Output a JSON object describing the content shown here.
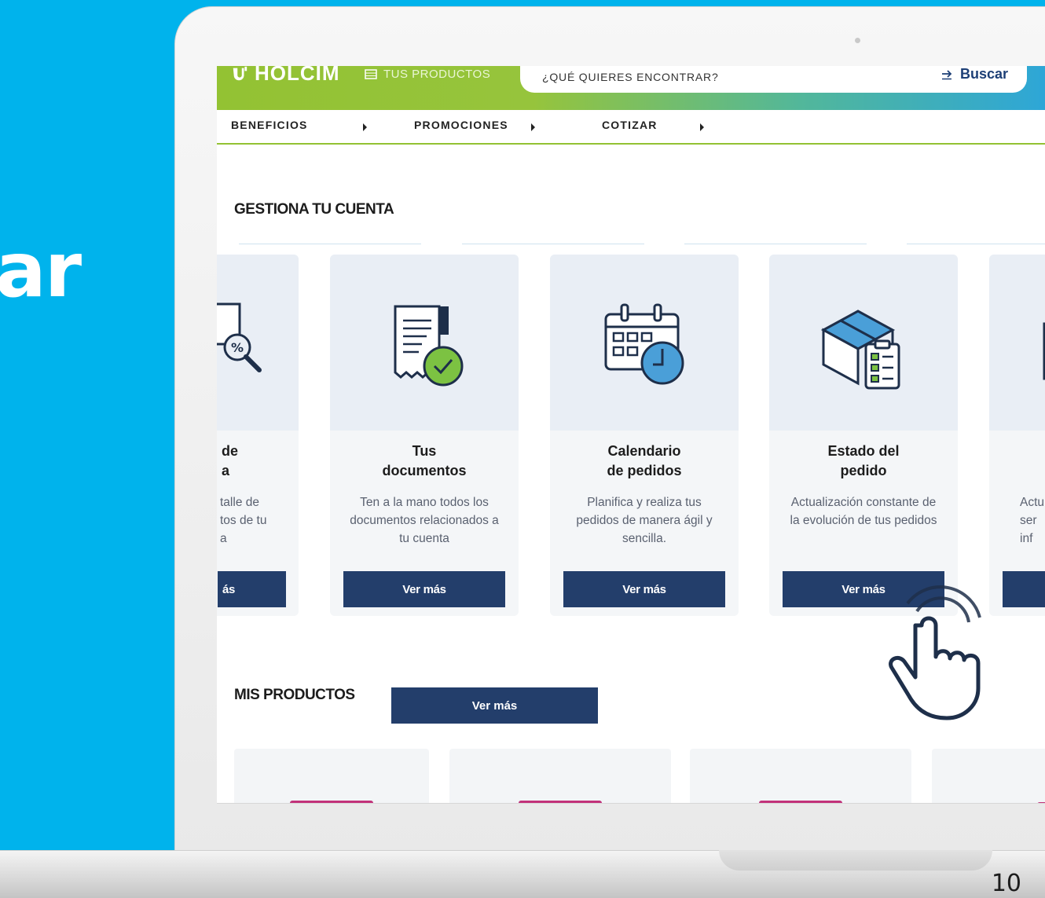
{
  "slide": {
    "word": "ar",
    "page_number": "10"
  },
  "header": {
    "logo_text": "HOLCIM",
    "products_link": "TUS PRODUCTOS",
    "search": {
      "placeholder": "¿QUÉ QUIERES ENCONTRAR?",
      "button_label": "Buscar"
    },
    "nav": [
      "BENEFICIOS",
      "PROMOCIONES",
      "COTIZAR"
    ]
  },
  "account": {
    "title": "GESTIONA TU CUENTA",
    "cards": [
      {
        "title": "de\na",
        "description": "talle de\ntos de tu\na",
        "button": "ás",
        "icon": "receipt-search-icon"
      },
      {
        "title": "Tus\ndocumentos",
        "description": "Ten a la mano todos los documentos relacionados a tu cuenta",
        "button": "Ver más",
        "icon": "document-check-icon"
      },
      {
        "title": "Calendario\nde pedidos",
        "description": "Planifica y realiza tus pedidos de manera ágil y sencilla.",
        "button": "Ver más",
        "icon": "calendar-clock-icon"
      },
      {
        "title": "Estado del\npedido",
        "description": "Actualización constante de la evolución de tus pedidos",
        "button": "Ver más",
        "icon": "box-checklist-icon"
      },
      {
        "title": "",
        "description": "Actu\nser\ninf",
        "button": "",
        "icon": "document-icon"
      }
    ]
  },
  "products": {
    "title": "MIS PRODUCTOS",
    "button": "Ver más"
  },
  "colors": {
    "background": "#00b3ec",
    "primary_button": "#233e6b",
    "brand_green": "#93c233",
    "brand_blue": "#2da6d8",
    "accent_green": "#7cc242"
  }
}
